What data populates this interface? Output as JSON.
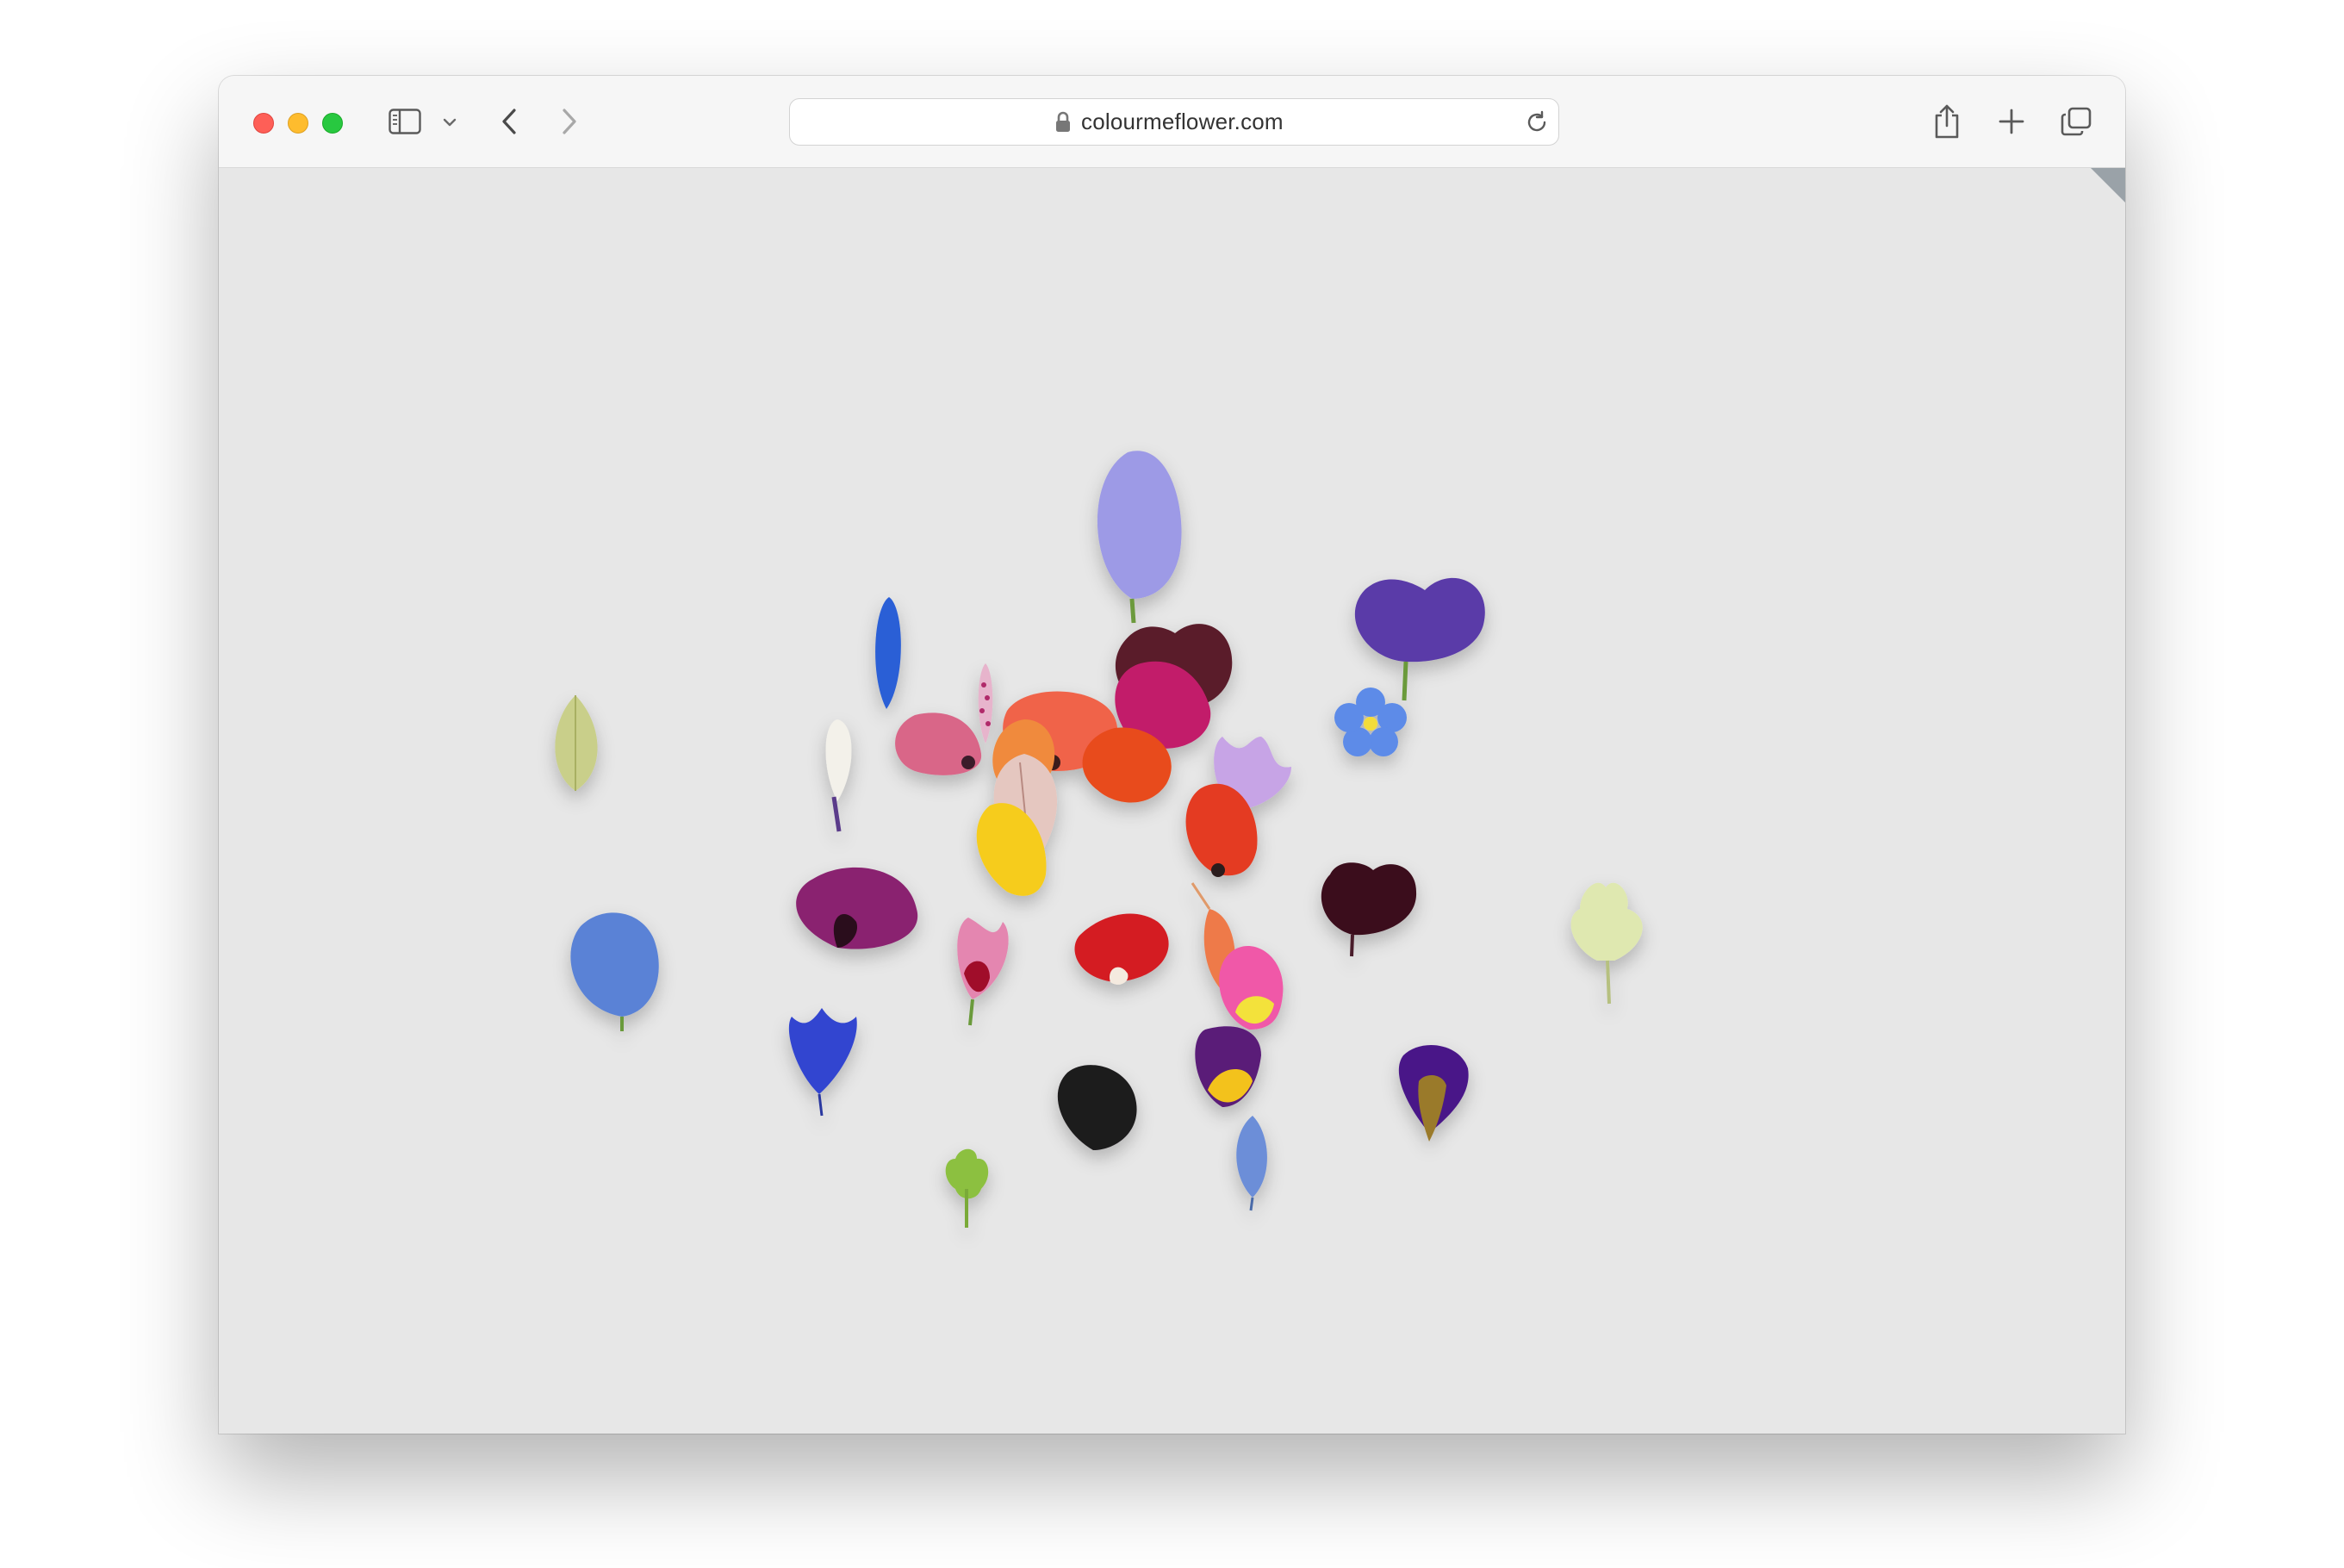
{
  "browser": {
    "url": "colourmeflower.com",
    "icons": {
      "sidebar": "sidebar-icon",
      "chevron": "chevron-down-icon",
      "back": "back-arrow-icon",
      "forward": "forward-arrow-icon",
      "lock": "lock-icon",
      "reload": "reload-icon",
      "share": "share-icon",
      "new_tab": "plus-icon",
      "tabs": "tab-overview-icon"
    }
  },
  "colors": {
    "content_background": "#e7e7e7",
    "toolbar_background": "#f6f6f6"
  },
  "petals": [
    {
      "name": "lavender-petal",
      "color": "#9d9ae6"
    },
    {
      "name": "blue-slim-petal",
      "color": "#2c5fd6"
    },
    {
      "name": "violet-pansy-petal",
      "color": "#5a3aa8"
    },
    {
      "name": "dark-maroon-petal",
      "color": "#5a1a2a"
    },
    {
      "name": "green-leaf-petal",
      "color": "#c9cf8a"
    },
    {
      "name": "white-petal",
      "color": "#f3f1ea"
    },
    {
      "name": "speckled-pink-spike",
      "color": "#c84a86"
    },
    {
      "name": "coral-petal",
      "color": "#f0644a"
    },
    {
      "name": "magenta-petal",
      "color": "#c21e6a"
    },
    {
      "name": "forget-me-not-flower",
      "color": "#5d8be8"
    },
    {
      "name": "pink-striped-petal",
      "color": "#d96688"
    },
    {
      "name": "orange-petal",
      "color": "#f08a3c"
    },
    {
      "name": "red-orange-petal",
      "color": "#e84b1e"
    },
    {
      "name": "lilac-crocus-petal",
      "color": "#c7a4e6"
    },
    {
      "name": "beige-pink-petal",
      "color": "#e5c7c0"
    },
    {
      "name": "yellow-petal",
      "color": "#f6cc1c"
    },
    {
      "name": "red-tulip-petal",
      "color": "#e43a22"
    },
    {
      "name": "dark-violet-flower",
      "color": "#3a0a1a"
    },
    {
      "name": "pale-yellow-flower",
      "color": "#dfe8b0"
    },
    {
      "name": "blue-round-petal",
      "color": "#5a82d6"
    },
    {
      "name": "plum-shell-petal",
      "color": "#8a2470"
    },
    {
      "name": "pink-small-petal",
      "color": "#e486b0"
    },
    {
      "name": "red-fringed-petal",
      "color": "#d41a22"
    },
    {
      "name": "salmon-tube-flower",
      "color": "#ee7a4a"
    },
    {
      "name": "pink-yellow-tulip-petal",
      "color": "#f058a8"
    },
    {
      "name": "blue-cornflower-petal",
      "color": "#3044d0"
    },
    {
      "name": "purple-yellow-petal",
      "color": "#5a1e78"
    },
    {
      "name": "black-petal",
      "color": "#1f1a1f"
    },
    {
      "name": "purple-iris-petal",
      "color": "#4a1888"
    },
    {
      "name": "green-star-flower",
      "color": "#8cc040"
    },
    {
      "name": "light-blue-petal",
      "color": "#6c8ed8"
    }
  ]
}
